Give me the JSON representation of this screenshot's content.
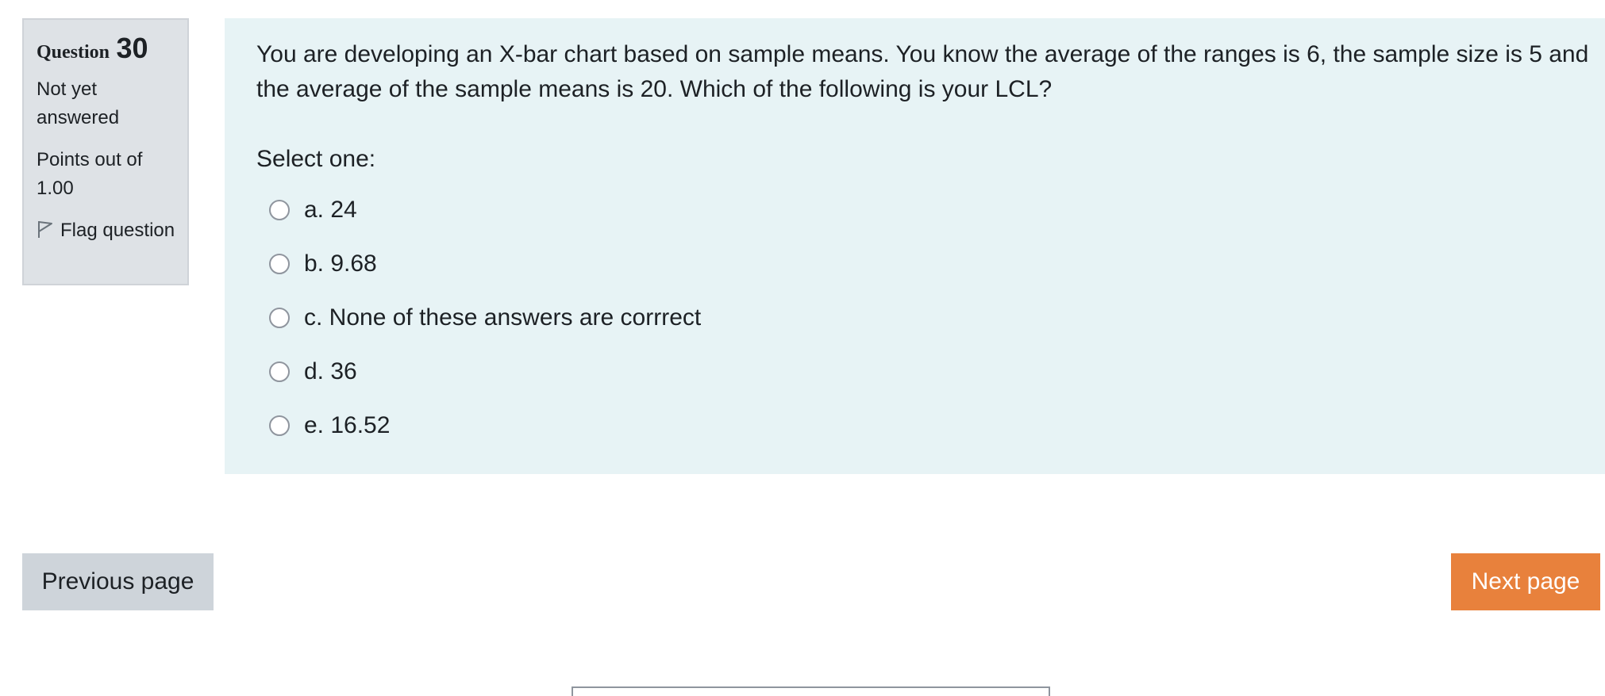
{
  "question_info": {
    "prefix": "Question",
    "number": "30",
    "state": "Not yet answered",
    "grade": "Points out of 1.00",
    "flag_label": "Flag question",
    "flag_icon": "flag-icon"
  },
  "question": {
    "text": "You are developing an X-bar chart based on sample means. You know the average of the ranges is 6, the sample size is 5 and the average of the sample means is 20. Which of the following is your LCL?",
    "prompt": "Select one:",
    "answers": [
      {
        "label": "a. 24",
        "selected": false
      },
      {
        "label": "b. 9.68",
        "selected": false
      },
      {
        "label": "c. None of these answers are corrrect",
        "selected": false
      },
      {
        "label": "d. 36",
        "selected": false
      },
      {
        "label": "e. 16.52",
        "selected": false
      }
    ]
  },
  "navigation": {
    "previous_label": "Previous page",
    "next_label": "Next page"
  },
  "colors": {
    "info_bg": "#dee2e6",
    "content_bg": "#e7f3f5",
    "next_button": "#e8813c",
    "prev_button": "#ced4da"
  }
}
